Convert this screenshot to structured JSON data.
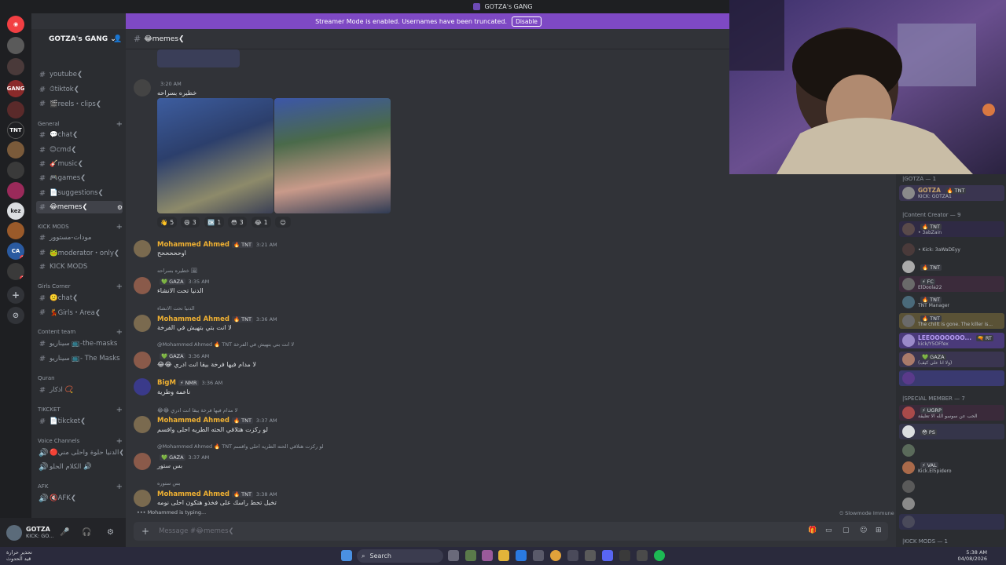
{
  "window": {
    "title": "GOTZA's GANG"
  },
  "banner": {
    "text": "Streamer Mode is enabled. Usernames have been truncated.",
    "button": "Disable"
  },
  "server": {
    "name": "GOTZA's GANG"
  },
  "channels": [
    {
      "name": "youtube❮",
      "top": 0
    },
    {
      "name": "⏱tiktok❮"
    },
    {
      "name": "🎬reels・clips❮"
    }
  ],
  "categories": {
    "general": "General",
    "kick_mods": "KICK MODS",
    "girls": "Girls Corner",
    "content": "Content team",
    "quran": "Quran",
    "ticket": "TIKCKET",
    "voice": "Voice Channels",
    "afk": "AFK"
  },
  "general_channels": [
    "💬chat❮",
    "😊cmd❮",
    "🎸music❮",
    "🎮games❮",
    "📄suggestions❮",
    "😂memes❮"
  ],
  "kick_channels": [
    "مودات-مستوور",
    "🐸moderator・only❮",
    "KICK MODS"
  ],
  "girls_channels": [
    "🙁chat❮",
    "💃Girls・Area❮"
  ],
  "content_channels": [
    "سيناريو 📺-the-masks",
    "سيناريو 📺- The Masks"
  ],
  "quran_channels": [
    "اذكار 📿"
  ],
  "ticket_channels": [
    "📄tikcket❮"
  ],
  "voice_channels": [
    "🔴الدنيا حلوة واحلى مني❮",
    "الكلام الحلو 🔊"
  ],
  "afk_channels": [
    "🔇AFK❮"
  ],
  "chat": {
    "channel": "😂memes❮",
    "messages": [
      {
        "author": "",
        "time": "3:20 AM",
        "text": "خطيره بسراحه"
      },
      {
        "author": "Mohammed Ahmed",
        "tag": "🔥 TNT",
        "time": "3:21 AM",
        "text": "اوحححححح"
      },
      {
        "reply": "خطيره بسراحه 🖼",
        "author": "",
        "tag": "💚 GAZA",
        "time": "3:35 AM",
        "text": "الدنيا تحت الانشاء"
      },
      {
        "reply": "الدنيا تحت الانشاء",
        "author": "Mohammed Ahmed",
        "tag": "🔥 TNT",
        "time": "3:36 AM",
        "text": "لا انت بتي بتهيش في الفرخة"
      },
      {
        "reply": "@Mohammed Ahmed 🔥 TNT  لا انت بتي بتهيش في الفرخة",
        "author": "",
        "tag": "💚 GAZA",
        "time": "3:36 AM",
        "text": "😂😂 لا مدام فيها فرخة بيقا انت ادري"
      },
      {
        "author": "BigM",
        "tag": "⚡ NMR",
        "time": "3:36 AM",
        "text": "ناعمة وطرية"
      },
      {
        "reply": "😂😂 لا مدام فيها فرخة يبقا انت ادري",
        "author": "Mohammed Ahmed",
        "tag": "🔥 TNT",
        "time": "3:37 AM",
        "text": "لو ركزت هتلاقي الحته الطريه احلى واقسم"
      },
      {
        "reply": "@Mohammed Ahmed 🔥 TNT  لو ركزت هتلاقي الحته الطريه احلى واقسم",
        "author": "",
        "tag": "💚 GAZA",
        "time": "3:37 AM",
        "text": "بس ستور"
      },
      {
        "reply": "بس ستوره",
        "author": "Mohammed Ahmed",
        "tag": "🔥 TNT",
        "time": "3:38 AM",
        "text": "تخيل تحط راسك على فخذو هتكون احلى نومه"
      }
    ],
    "reactions": [
      {
        "emoji": "👋",
        "count": "5"
      },
      {
        "emoji": "😄",
        "count": "3"
      },
      {
        "emoji": "🆗",
        "count": "1"
      },
      {
        "emoji": "😳",
        "count": "3"
      },
      {
        "emoji": "😂",
        "count": "1"
      }
    ],
    "typing": "Mohammed is typing...",
    "slowmode": "Slowmode Immune",
    "composer_placeholder": "Message #😂memes❮"
  },
  "members": {
    "groups": [
      {
        "title": "|GOTZA — 1"
      },
      {
        "title": "|Content Creator — 9"
      },
      {
        "title": "|SPECIAL MEMBER — 7"
      },
      {
        "title": "|KICK MODS — 1"
      }
    ],
    "list": [
      {
        "name": "GOTZA",
        "tag": "🔥 TNT",
        "status": "KICK: GOTZA1",
        "color": "#c9a46a"
      },
      {
        "name": "",
        "tag": "🔥 TNT",
        "status": "• 3abZain",
        "color": "#6e4fc4"
      },
      {
        "name": "",
        "tag": "",
        "status": "• Kick: 3aWaDEyy",
        "color": "#6e4fc4"
      },
      {
        "name": "",
        "tag": "🔥 TNT",
        "status": "",
        "color": "#dbdee1"
      },
      {
        "name": "",
        "tag": "⚡ FC",
        "status": "ElDoola22",
        "color": "#6e4fc4"
      },
      {
        "name": "",
        "tag": "🔥 TNT",
        "status": "TNT Manager",
        "color": "#6e4fc4"
      },
      {
        "name": "",
        "tag": "🔥 TNT",
        "status": "The chillt is gone. The killer is...",
        "color": "#f0b132"
      },
      {
        "name": "LEEOOOOOOO...",
        "tag": "🔫 RT",
        "status": "kick/Y5OFfex",
        "color": "#b69cf2"
      },
      {
        "name": "",
        "tag": "💚 GAZA",
        "status": "(ولا انا على كيف)",
        "color": "#dbdee1"
      },
      {
        "name": "",
        "tag": "⚡ UGRP",
        "status": "الحب عن سوسو الله الا تعليقة",
        "color": "#f23f43"
      },
      {
        "name": "",
        "tag": "😳 PS",
        "status": "",
        "color": "#6e4fc4"
      },
      {
        "name": "",
        "tag": "",
        "status": "",
        "color": "#6e4fc4"
      },
      {
        "name": "",
        "tag": "⚡ VAL",
        "status": "Kick.El5pidero",
        "color": "#6e4fc4"
      },
      {
        "name": "",
        "tag": "",
        "status": "",
        "color": "#6e4fc4"
      },
      {
        "name": "",
        "tag": "",
        "status": "",
        "color": "#6e4fc4"
      }
    ]
  },
  "user": {
    "name": "GOTZA",
    "status": "KICK: GO..."
  },
  "taskbar": {
    "weather_line1": "تحذير حرارة",
    "weather_line2": "قيد الحدوث",
    "search": "Search",
    "time": "5:38 AM",
    "date": "04/08/2026"
  }
}
